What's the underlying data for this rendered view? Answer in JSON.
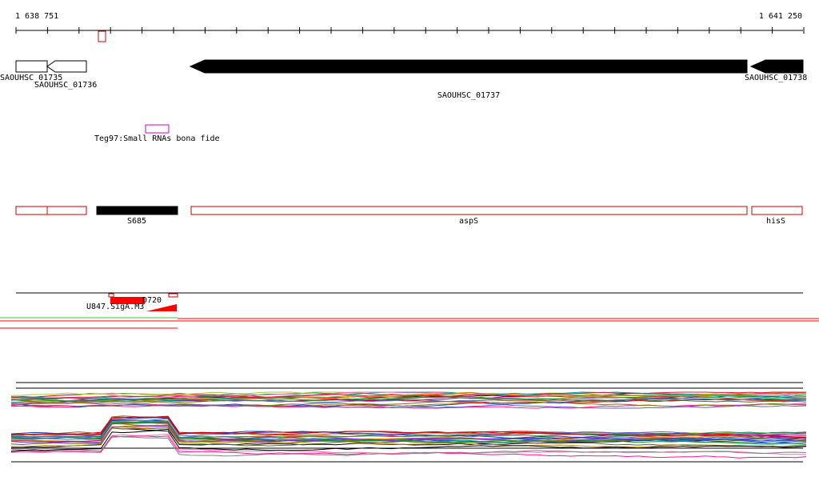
{
  "coordinates": {
    "start_label": "1 638 751",
    "end_label": "1 641 250",
    "start": 1638751,
    "end": 1641250
  },
  "colors": {
    "gene_fill": "#000000",
    "gene_outline": "#000000",
    "feature_outline": "#cc0000",
    "feature_red": "#ff0000",
    "srna_outline": "#cc00cc",
    "green_line": "#33cc33",
    "ruler": "#000000"
  },
  "genes": [
    {
      "label": "SAOUHSC_01735",
      "style": "outline"
    },
    {
      "label": "SAOUHSC_01736",
      "style": "outline"
    },
    {
      "label": "SAOUHSC_01737",
      "style": "filled"
    },
    {
      "label": "SAOUHSC_01738",
      "style": "filled"
    }
  ],
  "srna": {
    "label": "Teg97:Small RNAs bona fide"
  },
  "features": [
    {
      "label": "",
      "style": "outline"
    },
    {
      "label": "",
      "style": "outline"
    },
    {
      "label": "S685",
      "style": "filled"
    },
    {
      "label": "aspS",
      "style": "outline"
    },
    {
      "label": "hisS",
      "style": "outline"
    }
  ],
  "regulatory": {
    "label_left": "U847.SigA.M3",
    "label_right": "D720"
  }
}
